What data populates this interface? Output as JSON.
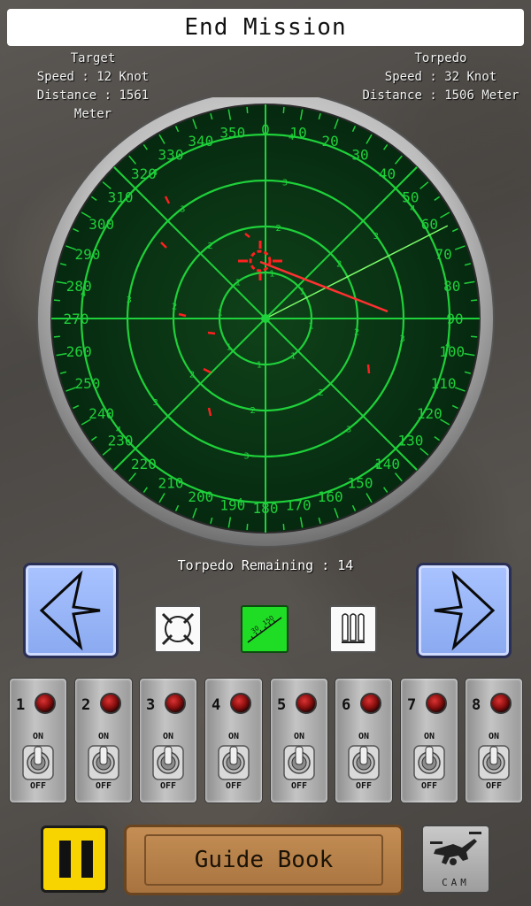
{
  "header": {
    "end_mission_label": "End Mission"
  },
  "target": {
    "title": "Target",
    "speed": "Speed : 12 Knot",
    "distance": "Distance : 1561 Meter"
  },
  "torpedo": {
    "title": "Torpedo",
    "speed": "Speed : 32 Knot",
    "distance": "Distance : 1506 Meter"
  },
  "radar": {
    "bearings": [
      "0",
      "10",
      "20",
      "30",
      "40",
      "50",
      "60",
      "70",
      "80",
      "90",
      "100",
      "110",
      "120",
      "130",
      "140",
      "150",
      "160",
      "170",
      "180",
      "190",
      "200",
      "210",
      "220",
      "230",
      "240",
      "250",
      "260",
      "270",
      "280",
      "290",
      "300",
      "310",
      "320",
      "330",
      "340",
      "350"
    ],
    "ring_labels": [
      "1",
      "2",
      "3",
      "4"
    ],
    "colors": {
      "screen": "#0d3a14",
      "grid": "#1fd13a",
      "contact": "#ff2020",
      "torpedo_line": "#ff3030",
      "sweep": "#7dff6a"
    }
  },
  "torpedo_remaining": "Torpedo Remaining : 14",
  "controls": {
    "left_arrow_icon": "arrow-left-icon",
    "right_arrow_icon": "arrow-right-icon",
    "modes": [
      "crosshair-mode-icon",
      "protractor-mode-icon",
      "torpedo-tubes-icon"
    ],
    "active_mode": "protractor-mode-icon",
    "protractor_labels": [
      "30",
      "150"
    ]
  },
  "switches": {
    "numbers": [
      "1",
      "2",
      "3",
      "4",
      "5",
      "6",
      "7",
      "8"
    ],
    "on_label": "ON",
    "off_label": "OFF"
  },
  "footer": {
    "guide_label": "Guide Book",
    "cam_label": "CAM",
    "pause_icon": "pause-icon",
    "cam_icon": "drone-camera-icon"
  }
}
